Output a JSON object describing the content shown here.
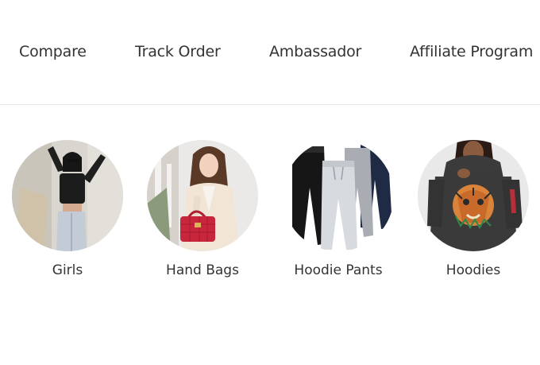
{
  "nav": {
    "items": [
      {
        "label": "Compare"
      },
      {
        "label": "Track Order"
      },
      {
        "label": "Ambassador"
      },
      {
        "label": "Affiliate Program"
      }
    ]
  },
  "categories": [
    {
      "label": "Girls",
      "image": "girls-photo"
    },
    {
      "label": "Hand Bags",
      "image": "handbag-photo"
    },
    {
      "label": "Hoodie Pants",
      "image": "hoodie-pants-photo"
    },
    {
      "label": "Hoodies",
      "image": "hoodie-photo"
    }
  ],
  "colors": {
    "text": "#333333",
    "divider": "#e6e6e6",
    "bag_red": "#c8263a",
    "tiger_orange": "#d9843a"
  }
}
